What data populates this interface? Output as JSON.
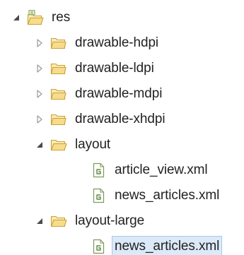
{
  "tree": {
    "nodes": [
      {
        "label": "res",
        "icon": "package-folder-icon",
        "expanded": true,
        "has_toggle": true,
        "depth": 0
      },
      {
        "label": "drawable-hdpi",
        "icon": "folder-icon",
        "expanded": false,
        "has_toggle": true,
        "depth": 1
      },
      {
        "label": "drawable-ldpi",
        "icon": "folder-icon",
        "expanded": false,
        "has_toggle": true,
        "depth": 1
      },
      {
        "label": "drawable-mdpi",
        "icon": "folder-icon",
        "expanded": false,
        "has_toggle": true,
        "depth": 1
      },
      {
        "label": "drawable-xhdpi",
        "icon": "folder-icon",
        "expanded": false,
        "has_toggle": true,
        "depth": 1
      },
      {
        "label": "layout",
        "icon": "folder-icon",
        "expanded": true,
        "has_toggle": true,
        "depth": 1
      },
      {
        "label": "article_view.xml",
        "icon": "xml-file-icon",
        "has_toggle": false,
        "depth": 2
      },
      {
        "label": "news_articles.xml",
        "icon": "xml-file-icon",
        "has_toggle": false,
        "depth": 2
      },
      {
        "label": "layout-large",
        "icon": "folder-icon",
        "expanded": true,
        "has_toggle": true,
        "depth": 1
      },
      {
        "label": "news_articles.xml",
        "icon": "xml-file-icon",
        "has_toggle": false,
        "depth": 2,
        "selected": true
      }
    ]
  },
  "colors": {
    "folder_fill": "#f7dc8a",
    "folder_stroke": "#c9a23c",
    "file_stroke": "#7f9a5c",
    "toggle_color": "#555555",
    "selection_bg": "#dbe9f8"
  }
}
